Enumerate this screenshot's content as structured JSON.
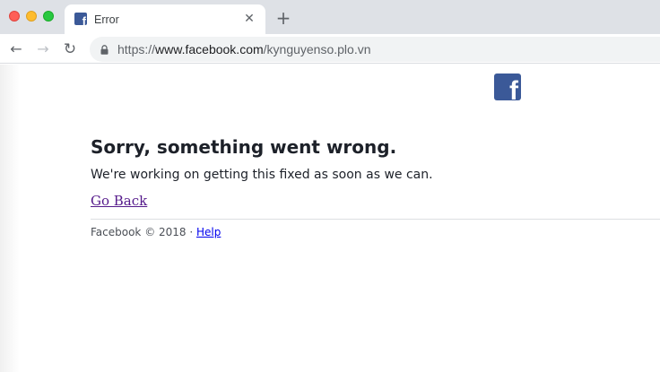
{
  "browser": {
    "tab": {
      "title": "Error",
      "favicon_icon": "facebook-icon",
      "close_glyph": "✕"
    },
    "new_tab_glyph": "+",
    "nav": {
      "back_glyph": "←",
      "forward_glyph": "→",
      "reload_glyph": "↻"
    },
    "address": {
      "prefix": "https://",
      "host": "www.facebook.com",
      "path": "/kynguyenso.plo.vn"
    }
  },
  "page": {
    "logo_glyph": "f",
    "title": "Sorry, something went wrong.",
    "message": "We're working on getting this fixed as soon as we can.",
    "go_back": "Go Back",
    "footer": {
      "copyright": "Facebook © 2018 · ",
      "help": "Help"
    }
  },
  "colors": {
    "brand": "#3b5998",
    "visited_link": "#551a8b",
    "link": "#0000ee"
  }
}
